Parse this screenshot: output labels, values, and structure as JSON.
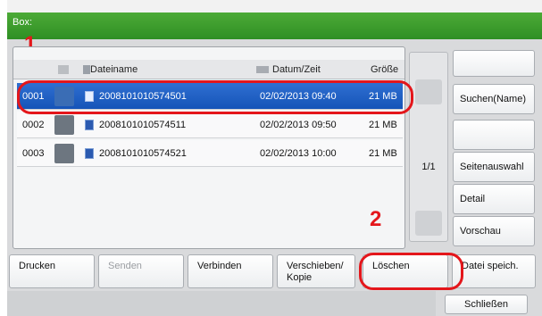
{
  "header": {
    "title": "Box:"
  },
  "markers": {
    "one": "1",
    "two": "2"
  },
  "columns": {
    "name": "Dateiname",
    "date": "Datum/Zeit",
    "size": "Größe"
  },
  "rows": [
    {
      "id": "0001",
      "name": "2008101010574501",
      "date": "02/02/2013 09:40",
      "size": "21  MB",
      "selected": true
    },
    {
      "id": "0002",
      "name": "2008101010574511",
      "date": "02/02/2013 09:50",
      "size": "21  MB",
      "selected": false
    },
    {
      "id": "0003",
      "name": "2008101010574521",
      "date": "02/02/2013 10:00",
      "size": "21  MB",
      "selected": false
    }
  ],
  "pagination": {
    "label": "1/1"
  },
  "side_buttons": {
    "search": "Suchen(Name)",
    "page_select": "Seitenauswahl",
    "detail": "Detail",
    "preview": "Vorschau"
  },
  "bottom_buttons": {
    "print": "Drucken",
    "send": "Senden",
    "combine": "Verbinden",
    "move_line1": "Verschieben/",
    "move_line2": "Kopie",
    "delete": "Löschen",
    "save_file": "Datei speich."
  },
  "close": "Schließen",
  "colors": {
    "header_green": "#3a9c2e",
    "selection_blue": "#1f5fc4",
    "highlight_red": "#e4161b"
  }
}
